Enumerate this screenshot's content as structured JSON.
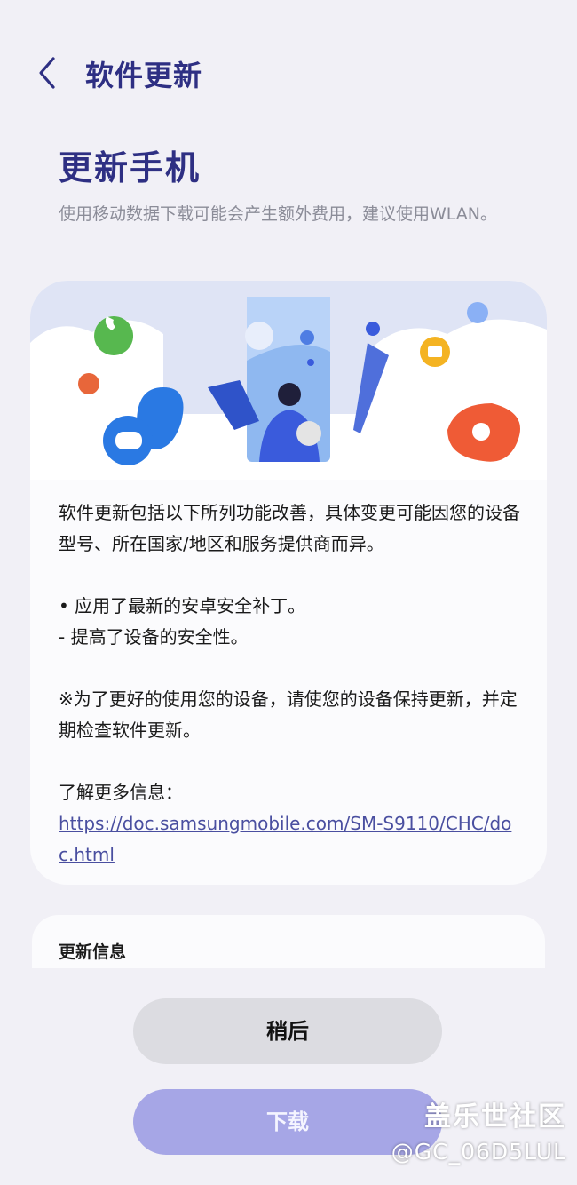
{
  "header": {
    "title": "软件更新"
  },
  "page": {
    "title": "更新手机",
    "subtitle": "使用移动数据下载可能会产生额外费用，建议使用WLAN。"
  },
  "card": {
    "intro": "软件更新包括以下所列功能改善，具体变更可能因您的设备型号、所在国家/地区和服务提供商而异。",
    "bullet1": "• 应用了最新的安卓安全补丁。",
    "bullet1_sub": " - 提高了设备的安全性。",
    "note": "※为了更好的使用您的设备，请使您的设备保持更新，并定期检查软件更新。",
    "more_label": "了解更多信息：",
    "link": "https://doc.samsungmobile.com/SM-S9110/CHC/doc.html"
  },
  "info_card": {
    "title": "更新信息"
  },
  "buttons": {
    "later": "稍后",
    "download": "下载"
  },
  "watermark": {
    "line1": "盖乐世社区",
    "line2": "@GC_06D5LUL"
  },
  "icons": [
    "back-chevron-icon",
    "phone-call-icon",
    "chat-bubble-icon",
    "contact-icon",
    "settings-icon",
    "folder-icon",
    "flower-icon",
    "pen-icon"
  ],
  "colors": {
    "accent": "#2e2f83",
    "download_button": "#a6a6e6",
    "later_button": "#dcdce1",
    "background": "#f1f0f6"
  }
}
